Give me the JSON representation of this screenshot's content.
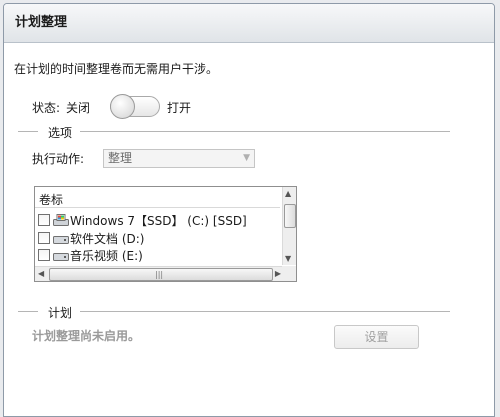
{
  "window": {
    "title": "计划整理"
  },
  "description": "在计划的时间整理卷而无需用户干涉。",
  "status": {
    "label": "状态:",
    "off_label": "关闭",
    "on_label": "打开",
    "enabled": false
  },
  "options_section": {
    "title": "选项"
  },
  "action": {
    "label": "执行动作:",
    "selected": "整理"
  },
  "volume_list": {
    "header": "卷标",
    "items": [
      {
        "label": "Windows 7【SSD】 (C:) [SSD]",
        "icon": "system-drive-icon",
        "checked": false
      },
      {
        "label": "软件文档 (D:)",
        "icon": "drive-icon",
        "checked": false
      },
      {
        "label": "音乐视频 (E:)",
        "icon": "drive-icon",
        "checked": false
      }
    ]
  },
  "schedule_section": {
    "title": "计划",
    "status_text": "计划整理尚未启用。",
    "settings_button": "设置"
  }
}
